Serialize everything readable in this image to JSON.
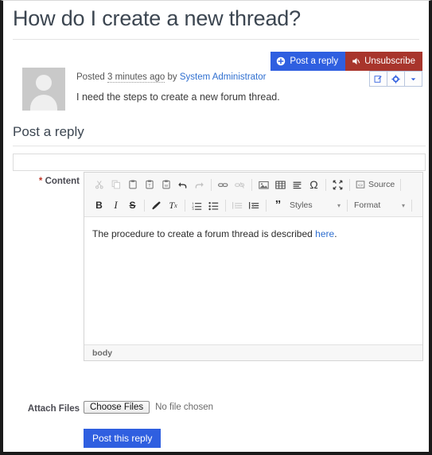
{
  "thread": {
    "title": "How do I create a new thread?",
    "post": {
      "posted_prefix": "Posted",
      "time_ago": "3 minutes ago",
      "by_label": "by",
      "author": "System Administrator",
      "body": "I need the steps to create a new forum thread."
    }
  },
  "actions": {
    "post_reply_label": "Post a reply",
    "unsubscribe_label": "Unsubscribe",
    "post_reply_color": "#2f5fe0",
    "unsubscribe_color": "#a8352c",
    "mini_buttons": [
      {
        "name": "edit-icon",
        "glyph": "✎"
      },
      {
        "name": "gear-icon",
        "glyph": "⚙"
      },
      {
        "name": "chevron-down-icon",
        "glyph": "▾"
      }
    ]
  },
  "reply_form": {
    "section_title": "Post a reply",
    "subject_value": "",
    "subject_placeholder": "",
    "content_label": "Content",
    "required_mark": "*",
    "editor": {
      "toolbar_row1": [
        {
          "name": "cut-icon",
          "glyph": "✂",
          "dim": true
        },
        {
          "name": "copy-icon",
          "glyph": "⧉",
          "dim": true
        },
        {
          "name": "paste-icon",
          "glyph": "ὌB",
          "dim": false
        },
        {
          "name": "paste-text-icon",
          "glyph": "T",
          "dim": false
        },
        {
          "name": "paste-word-icon",
          "glyph": "W",
          "dim": false
        },
        {
          "name": "undo-icon",
          "glyph": "↶",
          "dim": false
        },
        {
          "name": "redo-icon",
          "glyph": "↷",
          "dim": true
        },
        {
          "name": "separator",
          "glyph": "",
          "dim": false
        },
        {
          "name": "link-icon",
          "glyph": "ὑ7",
          "dim": false
        },
        {
          "name": "unlink-icon",
          "glyph": "⛓",
          "dim": true
        },
        {
          "name": "separator",
          "glyph": "",
          "dim": false
        },
        {
          "name": "image-icon",
          "glyph": "ὛC",
          "dim": false
        },
        {
          "name": "table-icon",
          "glyph": "▦",
          "dim": false
        },
        {
          "name": "horizontal-rule-icon",
          "glyph": "☰",
          "dim": false
        },
        {
          "name": "special-character-icon",
          "glyph": "Ω",
          "dim": false
        },
        {
          "name": "maximize-icon",
          "glyph": "✥",
          "dim": false
        }
      ],
      "source_label": "Source",
      "toolbar_row2": [
        {
          "name": "bold-icon",
          "glyph": "B",
          "dim": false
        },
        {
          "name": "italic-icon",
          "glyph": "I",
          "dim": false
        },
        {
          "name": "strikethrough-icon",
          "glyph": "S",
          "dim": false
        },
        {
          "name": "separator",
          "glyph": "",
          "dim": false
        },
        {
          "name": "remove-format-brush-icon",
          "glyph": "✐",
          "dim": false
        },
        {
          "name": "remove-format-icon",
          "glyph": "Tx",
          "dim": false
        },
        {
          "name": "separator",
          "glyph": "",
          "dim": false
        },
        {
          "name": "numbered-list-icon",
          "glyph": "≣",
          "dim": false
        },
        {
          "name": "bulleted-list-icon",
          "glyph": "≡",
          "dim": false
        },
        {
          "name": "separator",
          "glyph": "",
          "dim": false
        },
        {
          "name": "outdent-icon",
          "glyph": "⇤",
          "dim": true
        },
        {
          "name": "indent-icon",
          "glyph": "⇥",
          "dim": false
        },
        {
          "name": "separator",
          "glyph": "",
          "dim": false
        },
        {
          "name": "blockquote-icon",
          "glyph": "”",
          "dim": false
        }
      ],
      "styles_dropdown": "Styles",
      "format_dropdown": "Format",
      "content_text_before_link": "The procedure to create a forum thread is described ",
      "content_link_text": "here",
      "content_text_after_link": ".",
      "element_path": "body"
    },
    "attach_label": "Attach Files",
    "choose_files_label": "Choose Files",
    "no_file_chosen": "No file chosen",
    "submit_label": "Post this reply"
  }
}
